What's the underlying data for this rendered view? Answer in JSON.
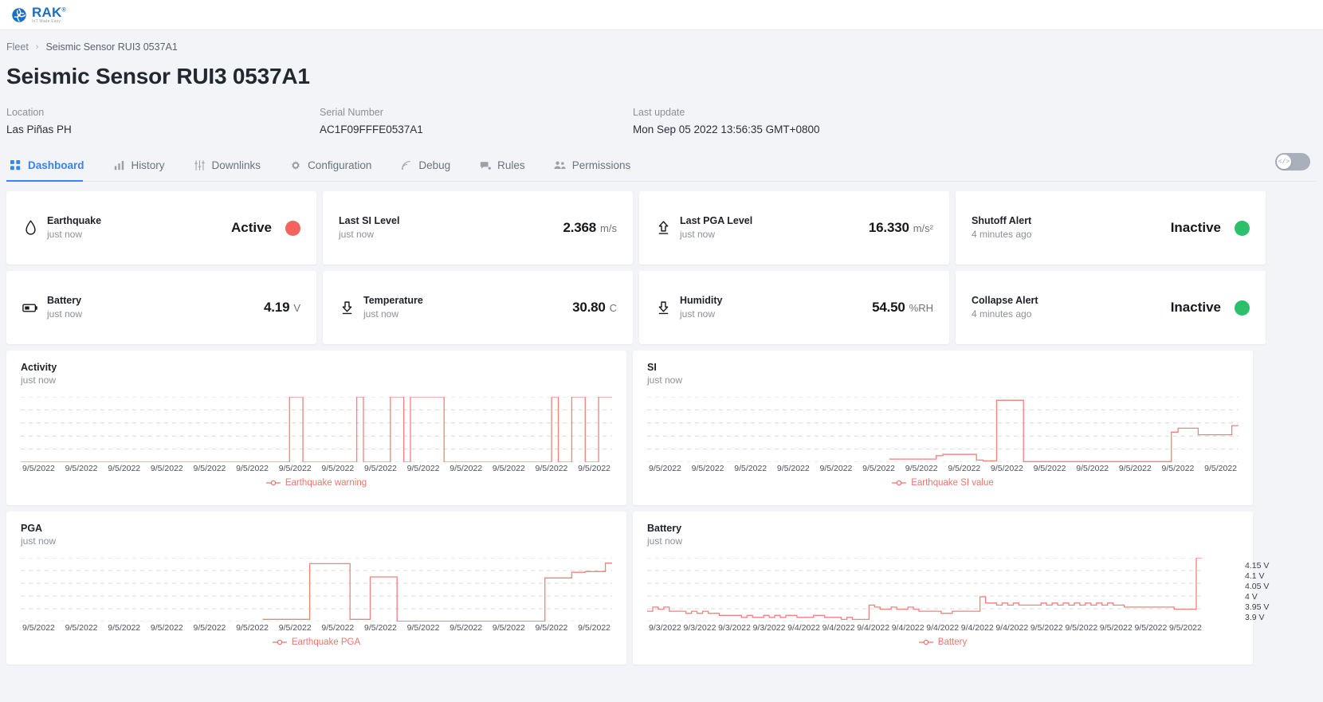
{
  "brand": {
    "name": "RAK",
    "trademark": "®",
    "tagline": "IoT Made Easy",
    "color": "#1a6fc4"
  },
  "breadcrumb": {
    "root": "Fleet",
    "separator": "›",
    "current": "Seismic Sensor RUI3 0537A1"
  },
  "header": {
    "title": "Seismic Sensor RUI3 0537A1",
    "meta": [
      {
        "label": "Location",
        "value": "Las Piñas PH"
      },
      {
        "label": "Serial Number",
        "value": "AC1F09FFFE0537A1"
      },
      {
        "label": "Last update",
        "value": "Mon Sep 05 2022 13:56:35 GMT+0800"
      }
    ]
  },
  "tabs": [
    {
      "label": "Dashboard",
      "icon": "grid-icon",
      "active": true
    },
    {
      "label": "History",
      "icon": "bar-chart-icon",
      "active": false
    },
    {
      "label": "Downlinks",
      "icon": "sliders-icon",
      "active": false
    },
    {
      "label": "Configuration",
      "icon": "gear-icon",
      "active": false
    },
    {
      "label": "Debug",
      "icon": "signal-icon",
      "active": false
    },
    {
      "label": "Rules",
      "icon": "chat-icon",
      "active": false
    },
    {
      "label": "Permissions",
      "icon": "users-icon",
      "active": false
    }
  ],
  "code_toggle": {
    "icon": "code-icon",
    "glyph": "</>",
    "state": "off",
    "track_color": "#aab0bb"
  },
  "stats": [
    {
      "name": "Earthquake",
      "time": "just now",
      "icon": "water-drop-icon",
      "status": "Active",
      "dot_color": "#f4645f",
      "value": "",
      "unit": ""
    },
    {
      "name": "Last SI Level",
      "time": "just now",
      "icon": "none",
      "status": "",
      "value": "2.368",
      "unit": "m/s"
    },
    {
      "name": "Last PGA Level",
      "time": "just now",
      "icon": "arrow-up-bar-icon",
      "status": "",
      "value": "16.330",
      "unit": "m/s²"
    },
    {
      "name": "Shutoff Alert",
      "time": "4 minutes ago",
      "icon": "none",
      "status": "Inactive",
      "dot_color": "#2cc06b",
      "value": "",
      "unit": ""
    },
    {
      "name": "Battery",
      "time": "just now",
      "icon": "battery-icon",
      "status": "",
      "value": "4.19",
      "unit": "V"
    },
    {
      "name": "Temperature",
      "time": "just now",
      "icon": "arrow-down-bar-icon",
      "status": "",
      "value": "30.80",
      "unit": "C"
    },
    {
      "name": "Humidity",
      "time": "just now",
      "icon": "arrow-down-bar-icon",
      "status": "",
      "value": "54.50",
      "unit": "%RH"
    },
    {
      "name": "Collapse Alert",
      "time": "4 minutes ago",
      "icon": "none",
      "status": "Inactive",
      "dot_color": "#2cc06b",
      "value": "",
      "unit": ""
    }
  ],
  "chart_data": [
    {
      "id": "activity",
      "type": "line",
      "title": "Activity",
      "subtitle": "just now",
      "legend": "Earthquake warning",
      "legend_position": "bottom-center",
      "line_color": "#f4817c",
      "grid": true,
      "xlabel": "",
      "ylabel": "",
      "ylim": [
        0,
        1
      ],
      "tick_labels": [
        "9/5/2022",
        "9/5/2022",
        "9/5/2022",
        "9/5/2022",
        "9/5/2022",
        "9/5/2022",
        "9/5/2022",
        "9/5/2022",
        "9/5/2022",
        "9/5/2022",
        "9/5/2022",
        "9/5/2022",
        "9/5/2022",
        "9/5/2022"
      ],
      "x": [
        0,
        1,
        2,
        3,
        4,
        5,
        6,
        7,
        8,
        9,
        10,
        11,
        12,
        13,
        14,
        15,
        16,
        17,
        18,
        19,
        20,
        21,
        22,
        23,
        24,
        25,
        26,
        27,
        28,
        29,
        30,
        31,
        32,
        33,
        34,
        35,
        36,
        37,
        38,
        39,
        40,
        41,
        42,
        43,
        44,
        45,
        46,
        47,
        48,
        49,
        50,
        51,
        52,
        53,
        54,
        55,
        56,
        57,
        58,
        59,
        60,
        61,
        62,
        63,
        64,
        65,
        66,
        67,
        68,
        69,
        70,
        71,
        72,
        73,
        74,
        75,
        76,
        77,
        78,
        79,
        80,
        81,
        82,
        83,
        84,
        85,
        86,
        87,
        88
      ],
      "values": [
        0,
        0,
        0,
        0,
        0,
        0,
        0,
        0,
        0,
        0,
        0,
        0,
        0,
        0,
        0,
        0,
        0,
        0,
        0,
        0,
        0,
        0,
        0,
        0,
        0,
        0,
        0,
        0,
        0,
        0,
        0,
        0,
        0,
        0,
        0,
        0,
        0,
        0,
        0,
        0,
        1,
        1,
        0,
        0,
        0,
        0,
        0,
        0,
        0,
        0,
        1,
        0,
        0,
        0,
        0,
        1,
        1,
        0,
        1,
        1,
        1,
        1,
        1,
        0,
        0,
        0,
        0,
        0,
        0,
        0,
        0,
        0,
        0,
        0,
        0,
        0,
        0,
        0,
        0,
        1,
        0,
        0,
        1,
        1,
        0,
        0,
        1,
        1,
        1
      ]
    },
    {
      "id": "si",
      "type": "line",
      "title": "SI",
      "subtitle": "just now",
      "legend": "Earthquake SI value",
      "legend_position": "bottom-center",
      "line_color": "#f4817c",
      "grid": true,
      "xlabel": "",
      "ylabel": "",
      "ylim": [
        0,
        2.5
      ],
      "tick_labels": [
        "9/5/2022",
        "9/5/2022",
        "9/5/2022",
        "9/5/2022",
        "9/5/2022",
        "9/5/2022",
        "9/5/2022",
        "9/5/2022",
        "9/5/2022",
        "9/5/2022",
        "9/5/2022",
        "9/5/2022",
        "9/5/2022",
        "9/5/2022"
      ],
      "x": [
        0,
        1,
        2,
        3,
        4,
        5,
        6,
        7,
        8,
        9,
        10,
        11,
        12,
        13,
        14,
        15,
        16,
        17,
        18,
        19,
        20,
        21,
        22,
        23,
        24,
        25,
        26,
        27,
        28,
        29,
        30,
        31,
        32,
        33,
        34,
        35,
        36,
        37,
        38,
        39,
        40,
        41,
        42,
        43,
        44,
        45,
        46,
        47,
        48,
        49,
        50,
        51,
        52,
        53,
        54,
        55,
        56,
        57,
        58,
        59,
        60,
        61,
        62,
        63,
        64,
        65,
        66,
        67,
        68,
        69,
        70,
        71,
        72,
        73,
        74,
        75,
        76,
        77,
        78,
        79,
        80,
        81,
        82,
        83,
        84,
        85,
        86,
        87,
        88
      ],
      "values": [
        null,
        null,
        null,
        null,
        null,
        null,
        null,
        null,
        null,
        null,
        null,
        null,
        null,
        null,
        null,
        null,
        null,
        null,
        null,
        null,
        null,
        null,
        null,
        null,
        null,
        null,
        null,
        null,
        null,
        null,
        null,
        null,
        null,
        null,
        null,
        null,
        0.12,
        0.12,
        0.12,
        0.12,
        0.12,
        0.12,
        0.12,
        0.25,
        0.3,
        0.3,
        0.3,
        0.3,
        0.3,
        0.08,
        0.05,
        0.05,
        2.37,
        2.37,
        2.37,
        2.37,
        0.02,
        0.02,
        0.02,
        0.02,
        0.02,
        0.02,
        0.02,
        0.02,
        0.02,
        0.02,
        0.02,
        0.02,
        0.02,
        0.02,
        0.02,
        0.02,
        0.02,
        0.02,
        0.02,
        0.02,
        0.02,
        0.02,
        1.15,
        1.3,
        1.3,
        1.3,
        1.05,
        1.05,
        1.05,
        1.05,
        1.05,
        1.4,
        1.4
      ]
    },
    {
      "id": "pga",
      "type": "line",
      "title": "PGA",
      "subtitle": "just now",
      "legend": "Earthquake PGA",
      "legend_position": "bottom-center",
      "line_color": "#f4817c",
      "grid": true,
      "xlabel": "",
      "ylabel": "",
      "ylim": [
        0,
        18
      ],
      "tick_labels": [
        "9/5/2022",
        "9/5/2022",
        "9/5/2022",
        "9/5/2022",
        "9/5/2022",
        "9/5/2022",
        "9/5/2022",
        "9/5/2022",
        "9/5/2022",
        "9/5/2022",
        "9/5/2022",
        "9/5/2022",
        "9/5/2022",
        "9/5/2022"
      ],
      "x": [
        0,
        1,
        2,
        3,
        4,
        5,
        6,
        7,
        8,
        9,
        10,
        11,
        12,
        13,
        14,
        15,
        16,
        17,
        18,
        19,
        20,
        21,
        22,
        23,
        24,
        25,
        26,
        27,
        28,
        29,
        30,
        31,
        32,
        33,
        34,
        35,
        36,
        37,
        38,
        39,
        40,
        41,
        42,
        43,
        44,
        45,
        46,
        47,
        48,
        49,
        50,
        51,
        52,
        53,
        54,
        55,
        56,
        57,
        58,
        59,
        60,
        61,
        62,
        63,
        64,
        65,
        66,
        67,
        68,
        69,
        70,
        71,
        72,
        73,
        74,
        75,
        76,
        77,
        78,
        79,
        80,
        81,
        82,
        83,
        84,
        85,
        86,
        87,
        88
      ],
      "values": [
        null,
        null,
        null,
        null,
        null,
        null,
        null,
        null,
        null,
        null,
        null,
        null,
        null,
        null,
        null,
        null,
        null,
        null,
        null,
        null,
        null,
        null,
        null,
        null,
        null,
        null,
        null,
        null,
        null,
        null,
        null,
        null,
        null,
        null,
        null,
        null,
        0.6,
        0.6,
        0.6,
        0.6,
        0.6,
        0.6,
        0.6,
        16.33,
        16.33,
        16.33,
        16.33,
        16.33,
        16.33,
        0.6,
        0.6,
        0.6,
        12.6,
        12.6,
        12.6,
        12.6,
        0.1,
        0.1,
        0.1,
        0.1,
        0.1,
        0.1,
        0.1,
        0.1,
        0.1,
        0.1,
        0.1,
        0.1,
        0.1,
        0.1,
        0.1,
        0.1,
        0.1,
        0.1,
        0.1,
        0.1,
        0.1,
        0.1,
        12.3,
        12.3,
        12.3,
        12.3,
        13.9,
        13.9,
        14.1,
        14.1,
        14.1,
        16.5,
        16.5
      ]
    },
    {
      "id": "battery",
      "type": "line",
      "title": "Battery",
      "subtitle": "just now",
      "legend": "Battery",
      "legend_position": "bottom-center",
      "line_color": "#f4817c",
      "grid": true,
      "xlabel": "",
      "ylabel": "V",
      "ylim": [
        3.88,
        4.19
      ],
      "y_ticks": [
        "4.15 V",
        "4.1 V",
        "4.05 V",
        "4 V",
        "3.95 V",
        "3.9 V"
      ],
      "y_tick_values": [
        4.15,
        4.1,
        4.05,
        4.0,
        3.95,
        3.9
      ],
      "tick_labels": [
        "9/3/2022",
        "9/3/2022",
        "9/3/2022",
        "9/3/2022",
        "9/4/2022",
        "9/4/2022",
        "9/4/2022",
        "9/4/2022",
        "9/4/2022",
        "9/4/2022",
        "9/4/2022",
        "9/5/2022",
        "9/5/2022",
        "9/5/2022",
        "9/5/2022",
        "9/5/2022"
      ],
      "x": [
        0,
        1,
        2,
        3,
        4,
        5,
        6,
        7,
        8,
        9,
        10,
        11,
        12,
        13,
        14,
        15,
        16,
        17,
        18,
        19,
        20,
        21,
        22,
        23,
        24,
        25,
        26,
        27,
        28,
        29,
        30,
        31,
        32,
        33,
        34,
        35,
        36,
        37,
        38,
        39,
        40,
        41,
        42,
        43,
        44,
        45,
        46,
        47,
        48,
        49,
        50,
        51,
        52,
        53,
        54,
        55,
        56,
        57,
        58,
        59,
        60,
        61,
        62,
        63,
        64,
        65,
        66,
        67,
        68,
        69,
        70,
        71,
        72,
        73,
        74,
        75,
        76,
        77,
        78,
        79,
        80,
        81,
        82,
        83,
        84,
        85,
        86,
        87,
        88,
        89,
        90,
        91,
        92,
        93,
        94,
        95,
        96,
        97,
        98,
        99,
        100
      ],
      "values": [
        3.93,
        3.95,
        3.94,
        3.95,
        3.93,
        3.93,
        3.93,
        3.92,
        3.93,
        3.92,
        3.93,
        3.92,
        3.92,
        3.91,
        3.91,
        3.91,
        3.91,
        3.9,
        3.91,
        3.9,
        3.9,
        3.91,
        3.9,
        3.91,
        3.9,
        3.91,
        3.91,
        3.9,
        3.9,
        3.9,
        3.91,
        3.91,
        3.9,
        3.9,
        3.9,
        3.89,
        3.9,
        3.89,
        3.89,
        3.89,
        3.96,
        3.95,
        3.94,
        3.94,
        3.95,
        3.94,
        3.94,
        3.95,
        3.94,
        3.93,
        3.93,
        3.93,
        3.93,
        3.92,
        3.92,
        3.93,
        3.93,
        3.93,
        3.93,
        3.93,
        4.0,
        3.97,
        3.97,
        3.96,
        3.97,
        3.96,
        3.97,
        3.96,
        3.96,
        3.96,
        3.96,
        3.97,
        3.96,
        3.97,
        3.96,
        3.97,
        3.96,
        3.97,
        3.96,
        3.97,
        3.96,
        3.97,
        3.96,
        3.97,
        3.96,
        3.96,
        3.95,
        3.95,
        3.95,
        3.95,
        3.95,
        3.95,
        3.95,
        3.95,
        3.95,
        3.94,
        3.94,
        3.94,
        3.94,
        4.19,
        4.19
      ]
    }
  ]
}
